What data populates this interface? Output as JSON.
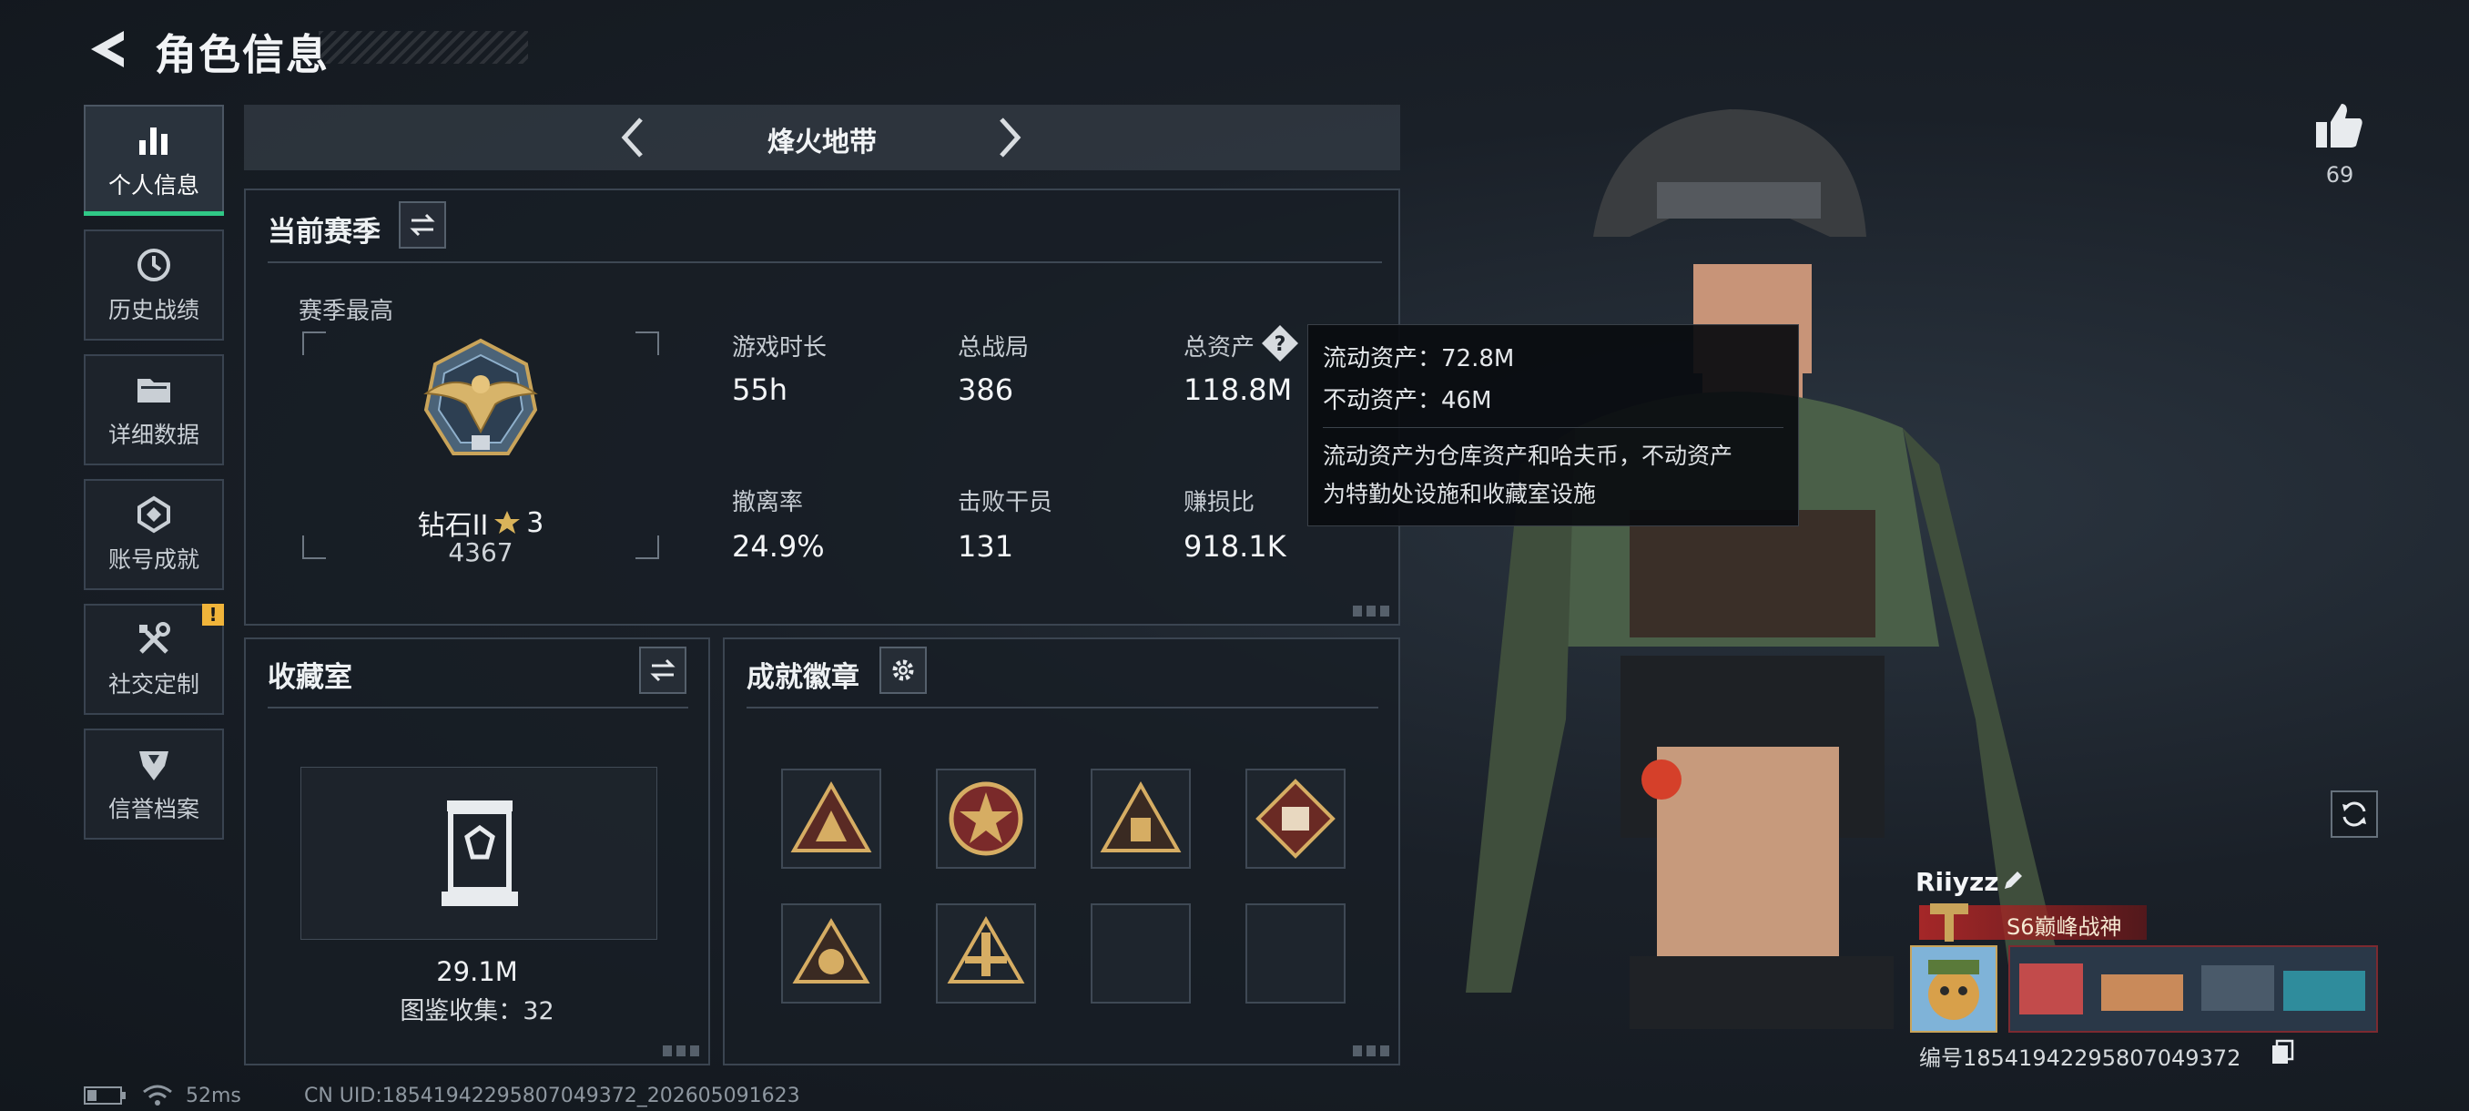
{
  "header": {
    "title": "角色信息"
  },
  "sidebar": {
    "items": [
      {
        "label": "个人信息",
        "icon": "bar-chart-icon",
        "active": true
      },
      {
        "label": "历史战绩",
        "icon": "history-icon",
        "active": false
      },
      {
        "label": "详细数据",
        "icon": "folder-icon",
        "active": false
      },
      {
        "label": "账号成就",
        "icon": "achievement-icon",
        "active": false
      },
      {
        "label": "社交定制",
        "icon": "tools-icon",
        "active": false,
        "badge": "!"
      },
      {
        "label": "信誉档案",
        "icon": "reputation-icon",
        "active": false
      }
    ]
  },
  "mode": {
    "title": "烽火地带"
  },
  "season": {
    "title": "当前赛季",
    "best_label": "赛季最高",
    "rank_name": "钻石II",
    "rank_stars": "3",
    "rank_score": "4367",
    "stats": [
      {
        "label": "游戏时长",
        "value": "55h"
      },
      {
        "label": "总战局",
        "value": "386"
      },
      {
        "label": "总资产",
        "value": "118.8M"
      },
      {
        "label": "撤离率",
        "value": "24.9%"
      },
      {
        "label": "击败干员",
        "value": "131"
      },
      {
        "label": "赚损比",
        "value": "918.1K"
      }
    ]
  },
  "tooltip": {
    "line1": "流动资产：72.8M",
    "line2": "不动资产：46M",
    "desc1": "流动资产为仓库资产和哈夫币，不动资产",
    "desc2": "为特勤处设施和收藏室设施"
  },
  "collection": {
    "title": "收藏室",
    "value": "29.1M",
    "count": "图鉴收集：32"
  },
  "achievements": {
    "title": "成就徽章"
  },
  "profile": {
    "likes": "69",
    "name": "Riiyzz",
    "title_badge": "S6巅峰战神",
    "id_text": "编号18541942295807049372"
  },
  "status": {
    "ping": "52ms",
    "uid": "CN UID:18541942295807049372_202605091623"
  },
  "colors": {
    "accent": "#30c886",
    "warning": "#f0b43a",
    "title_red": "#b42828"
  }
}
